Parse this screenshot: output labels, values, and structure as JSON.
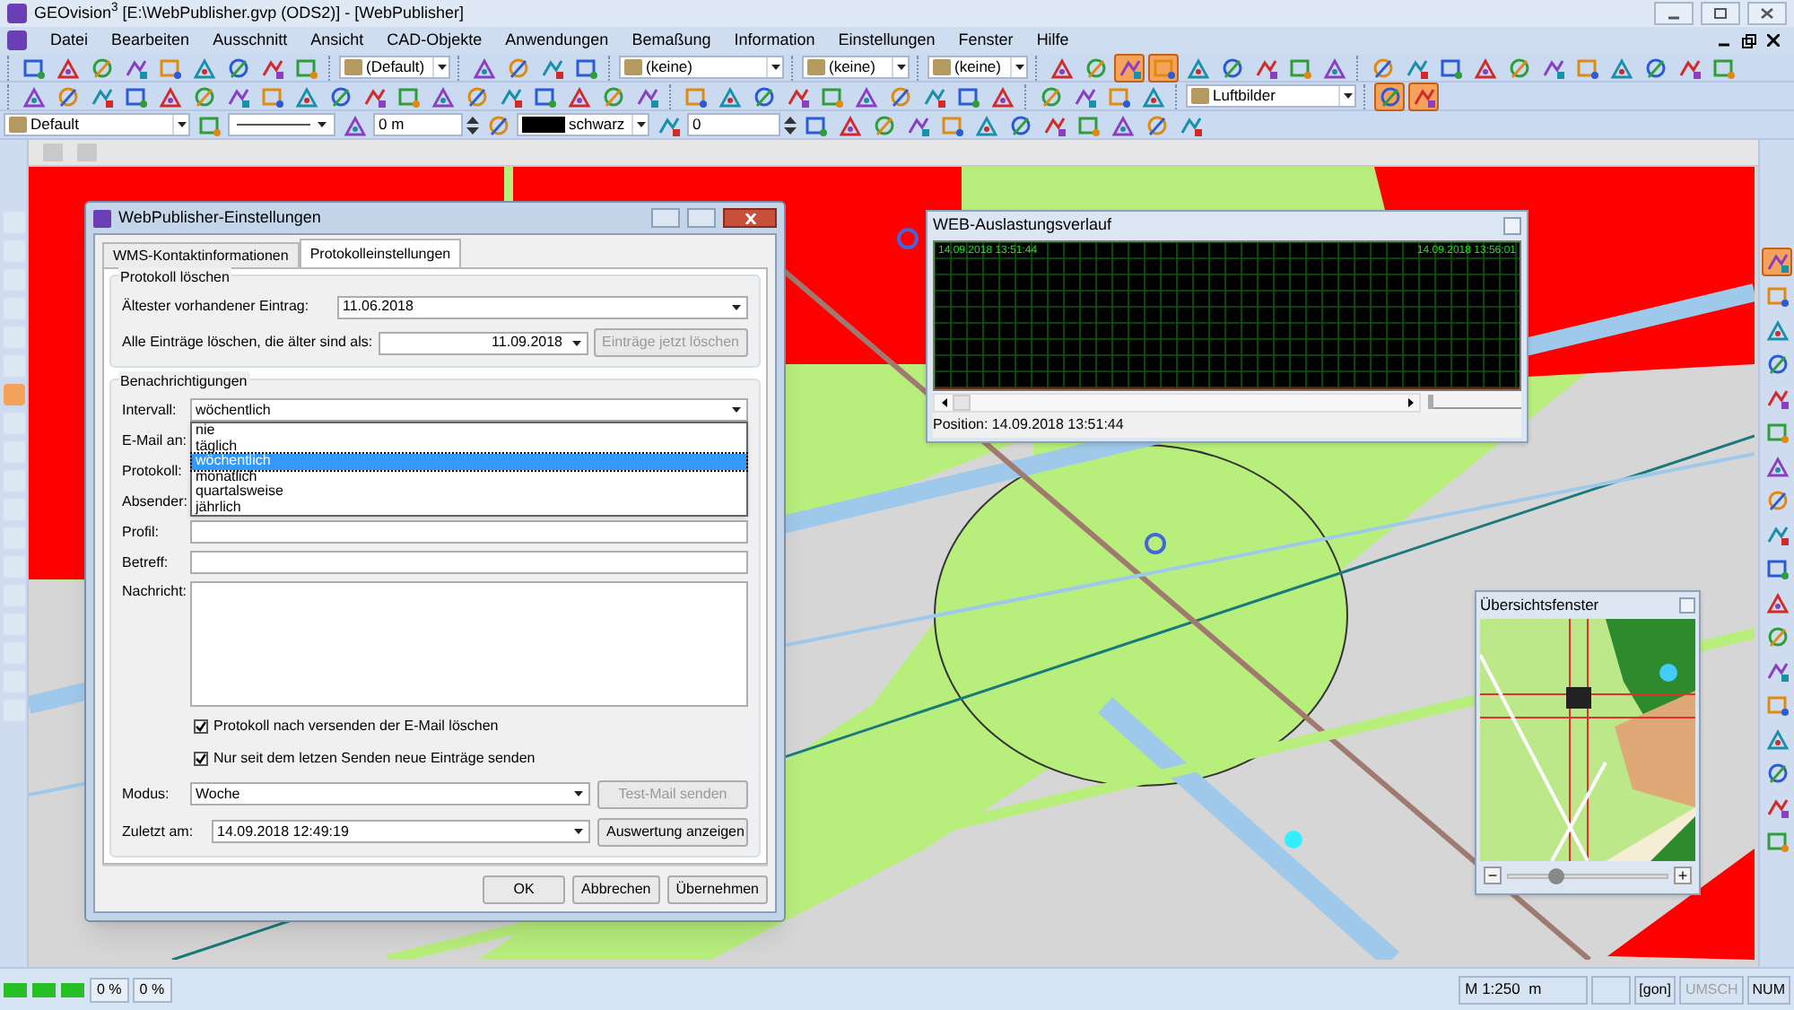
{
  "window": {
    "title": "GEOvision$^{3}$  [E:\\WebPublisher.gvp (ODS2)] - [WebPublisher]"
  },
  "menu": [
    "Datei",
    "Bearbeiten",
    "Ausschnitt",
    "Ansicht",
    "CAD-Objekte",
    "Anwendungen",
    "Bemaßung",
    "Information",
    "Einstellungen",
    "Fenster",
    "Hilfe"
  ],
  "toolbars": [
    {
      "items": [
        {
          "kind": "icons",
          "on": [
            false,
            false,
            false,
            false,
            false,
            false,
            false,
            false,
            false
          ]
        },
        {
          "kind": "dropdown",
          "value": "(Default)"
        },
        {
          "kind": "icons",
          "on": [
            false,
            false,
            false,
            false
          ]
        },
        {
          "kind": "dropdown",
          "value": "(keine)"
        },
        {
          "kind": "dropdown",
          "value": "(keine)"
        },
        {
          "kind": "dropdown",
          "value": "(keine)"
        },
        {
          "kind": "icons",
          "on": [
            false,
            false,
            true,
            true,
            false,
            false,
            false,
            false,
            false
          ]
        },
        {
          "kind": "icons",
          "on": [
            false,
            false,
            false,
            false,
            false,
            false,
            false,
            false,
            false,
            false,
            false
          ]
        }
      ]
    },
    {
      "items": [
        {
          "kind": "icons",
          "on": [
            false,
            false,
            false,
            false,
            false,
            false,
            false,
            false,
            false,
            false,
            false,
            false,
            false,
            false,
            false,
            false,
            false,
            false,
            false
          ]
        },
        {
          "kind": "icons",
          "on": [
            false,
            false,
            false,
            false,
            false,
            false,
            false,
            false,
            false,
            false
          ]
        },
        {
          "kind": "icons",
          "on": [
            false,
            false,
            false,
            false
          ]
        },
        {
          "kind": "dropdown",
          "value": "Luftbilder"
        },
        {
          "kind": "icons",
          "on": [
            true,
            true
          ]
        }
      ]
    },
    {
      "items": [
        {
          "kind": "dropdown",
          "value": "Default"
        },
        {
          "kind": "icons",
          "on": [
            false
          ]
        },
        {
          "kind": "line_style"
        },
        {
          "kind": "icons",
          "on": [
            false
          ]
        },
        {
          "kind": "spin",
          "value": "0 m"
        },
        {
          "kind": "icons",
          "on": [
            false
          ]
        },
        {
          "kind": "color",
          "value": "schwarz"
        },
        {
          "kind": "icons",
          "on": [
            false
          ]
        },
        {
          "kind": "spin",
          "value": "0"
        },
        {
          "kind": "icons",
          "on": [
            false,
            false,
            false,
            false,
            false,
            false,
            false,
            false,
            false,
            false,
            false,
            false
          ]
        }
      ]
    }
  ],
  "dialog": {
    "title": "WebPublisher-Einstellungen",
    "tabs": [
      {
        "label": "WMS-Kontaktinformationen",
        "selected": false
      },
      {
        "label": "Protokolleinstellungen",
        "selected": true
      }
    ],
    "delete_group": {
      "title": "Protokoll löschen",
      "oldest_label": "Ältester vorhandener Eintrag:",
      "oldest_value": "11.06.2018",
      "older_label": "Alle Einträge löschen, die älter sind als:",
      "older_value": "11.09.2018",
      "delete_button": {
        "label": "Einträge jetzt löschen",
        "disabled": true
      }
    },
    "notify_group": {
      "title": "Benachrichtigungen",
      "interval_label": "Intervall:",
      "interval_value": "wöchentlich",
      "interval_options": [
        {
          "label": "nie",
          "selected": false
        },
        {
          "label": "täglich",
          "selected": false
        },
        {
          "label": "wöchentlich",
          "selected": true
        },
        {
          "label": "monatlich",
          "selected": false
        },
        {
          "label": "quartalsweise",
          "selected": false
        },
        {
          "label": "jährlich",
          "selected": false
        }
      ],
      "hidden_labels": [
        "E-Mail an:",
        "Protokoll:",
        "Absender:"
      ],
      "profile_label": "Profil:",
      "subject_label": "Betreff:",
      "message_label": "Nachricht:",
      "checkboxes": [
        {
          "label": "Protokoll nach versenden der E-Mail löschen",
          "checked": true
        },
        {
          "label": "Nur seit dem letzen Senden neue Einträge senden",
          "checked": true
        }
      ],
      "mode_label": "Modus:",
      "mode_value": "Woche",
      "test_button": {
        "label": "Test-Mail senden",
        "disabled": true
      },
      "last_label": "Zuletzt am:",
      "last_value": "14.09.2018 12:49:19",
      "report_button": {
        "label": "Auswertung anzeigen",
        "disabled": false
      }
    },
    "buttons": [
      "OK",
      "Abbrechen",
      "Übernehmen"
    ]
  },
  "load_window": {
    "title": "WEB-Auslastungsverlauf",
    "start": "14.09.2018 13:51:44",
    "end": "14.09.2018 13:56:01",
    "zoom": {
      "level": 0
    },
    "position": "Position: 14.09.2018 13:51:44"
  },
  "overview": {
    "title": "Übersichtsfenster",
    "minus": "−",
    "plus": "+",
    "zoom": {
      "level": 0.3
    }
  },
  "status_bar": {
    "progress": [
      "0 %",
      "0 %"
    ],
    "scale": "M 1:250  m",
    "angle_unit": "[gon]",
    "indicators": [
      {
        "label": "UMSCH",
        "on": false
      },
      {
        "label": "NUM",
        "on": true
      }
    ]
  }
}
